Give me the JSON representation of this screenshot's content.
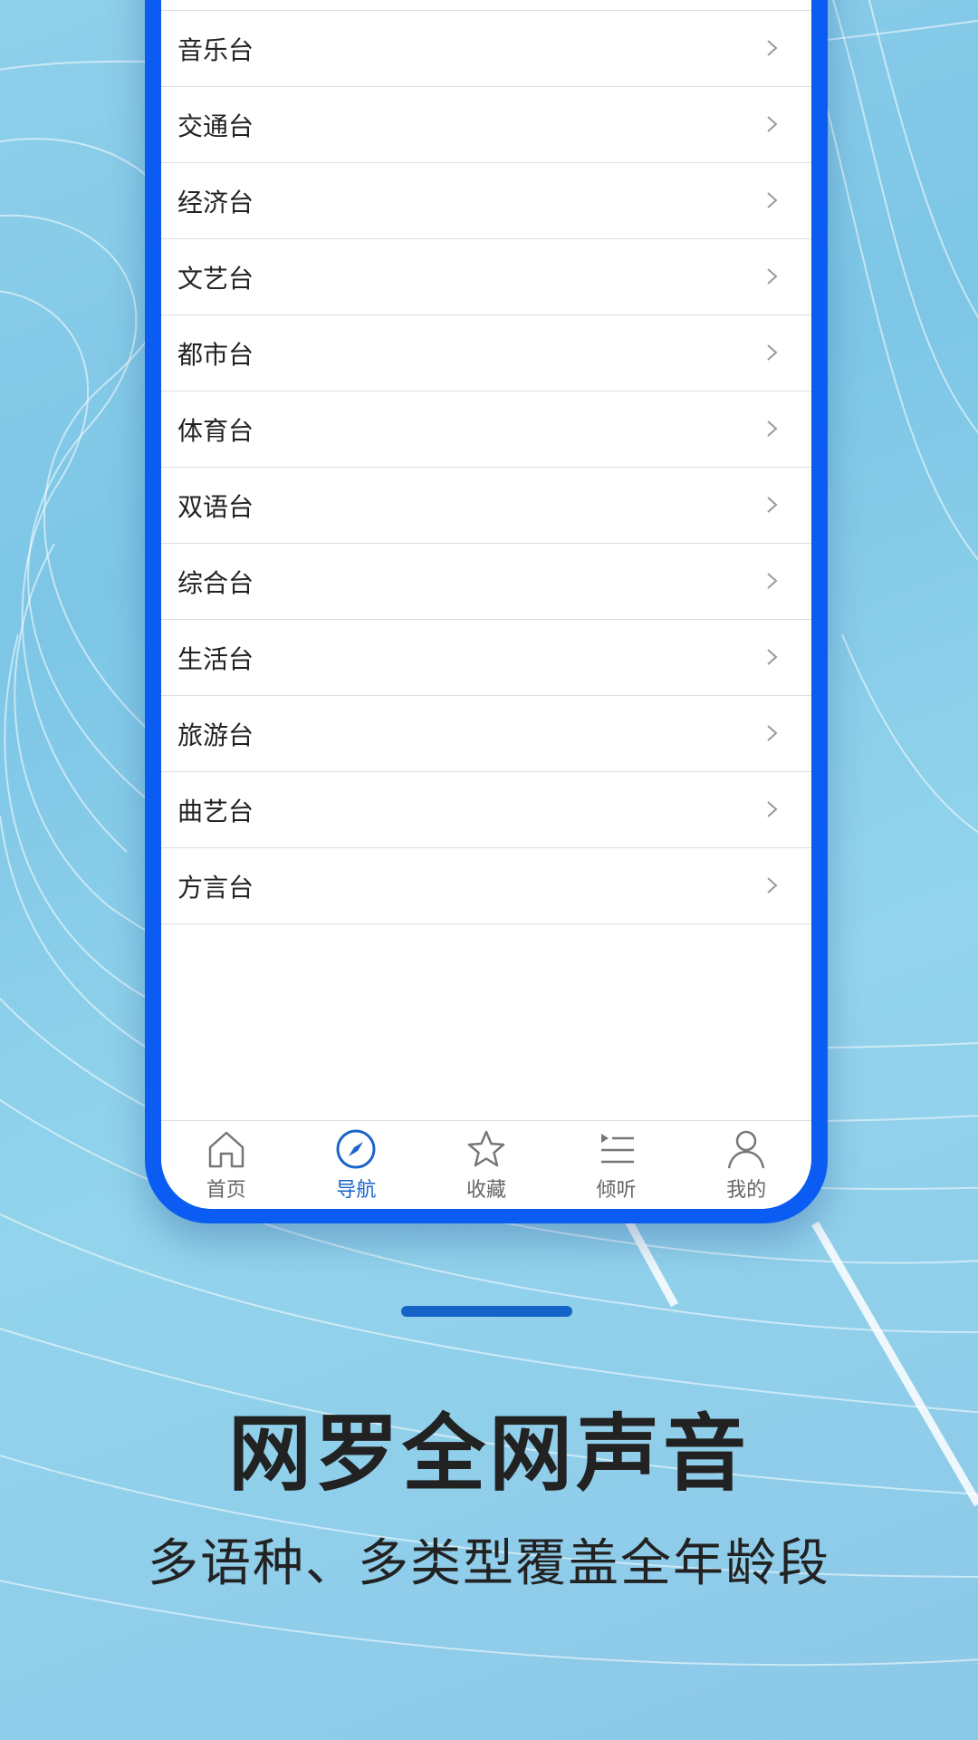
{
  "stations": [
    {
      "label": "音乐台"
    },
    {
      "label": "交通台"
    },
    {
      "label": "经济台"
    },
    {
      "label": "文艺台"
    },
    {
      "label": "都市台"
    },
    {
      "label": "体育台"
    },
    {
      "label": "双语台"
    },
    {
      "label": "综合台"
    },
    {
      "label": "生活台"
    },
    {
      "label": "旅游台"
    },
    {
      "label": "曲艺台"
    },
    {
      "label": "方言台"
    }
  ],
  "tabbar": {
    "tabs": [
      {
        "label": "首页",
        "icon": "home-icon",
        "active": false
      },
      {
        "label": "导航",
        "icon": "compass-icon",
        "active": true
      },
      {
        "label": "收藏",
        "icon": "star-icon",
        "active": false
      },
      {
        "label": "倾听",
        "icon": "playlist-icon",
        "active": false
      },
      {
        "label": "我的",
        "icon": "user-icon",
        "active": false
      }
    ]
  },
  "promo": {
    "headline": "网罗全网声音",
    "subline": "多语种、多类型覆盖全年龄段"
  },
  "colors": {
    "accent": "#0a5cf2",
    "active_tab": "#1a64c8",
    "indicator": "#1464c8"
  }
}
